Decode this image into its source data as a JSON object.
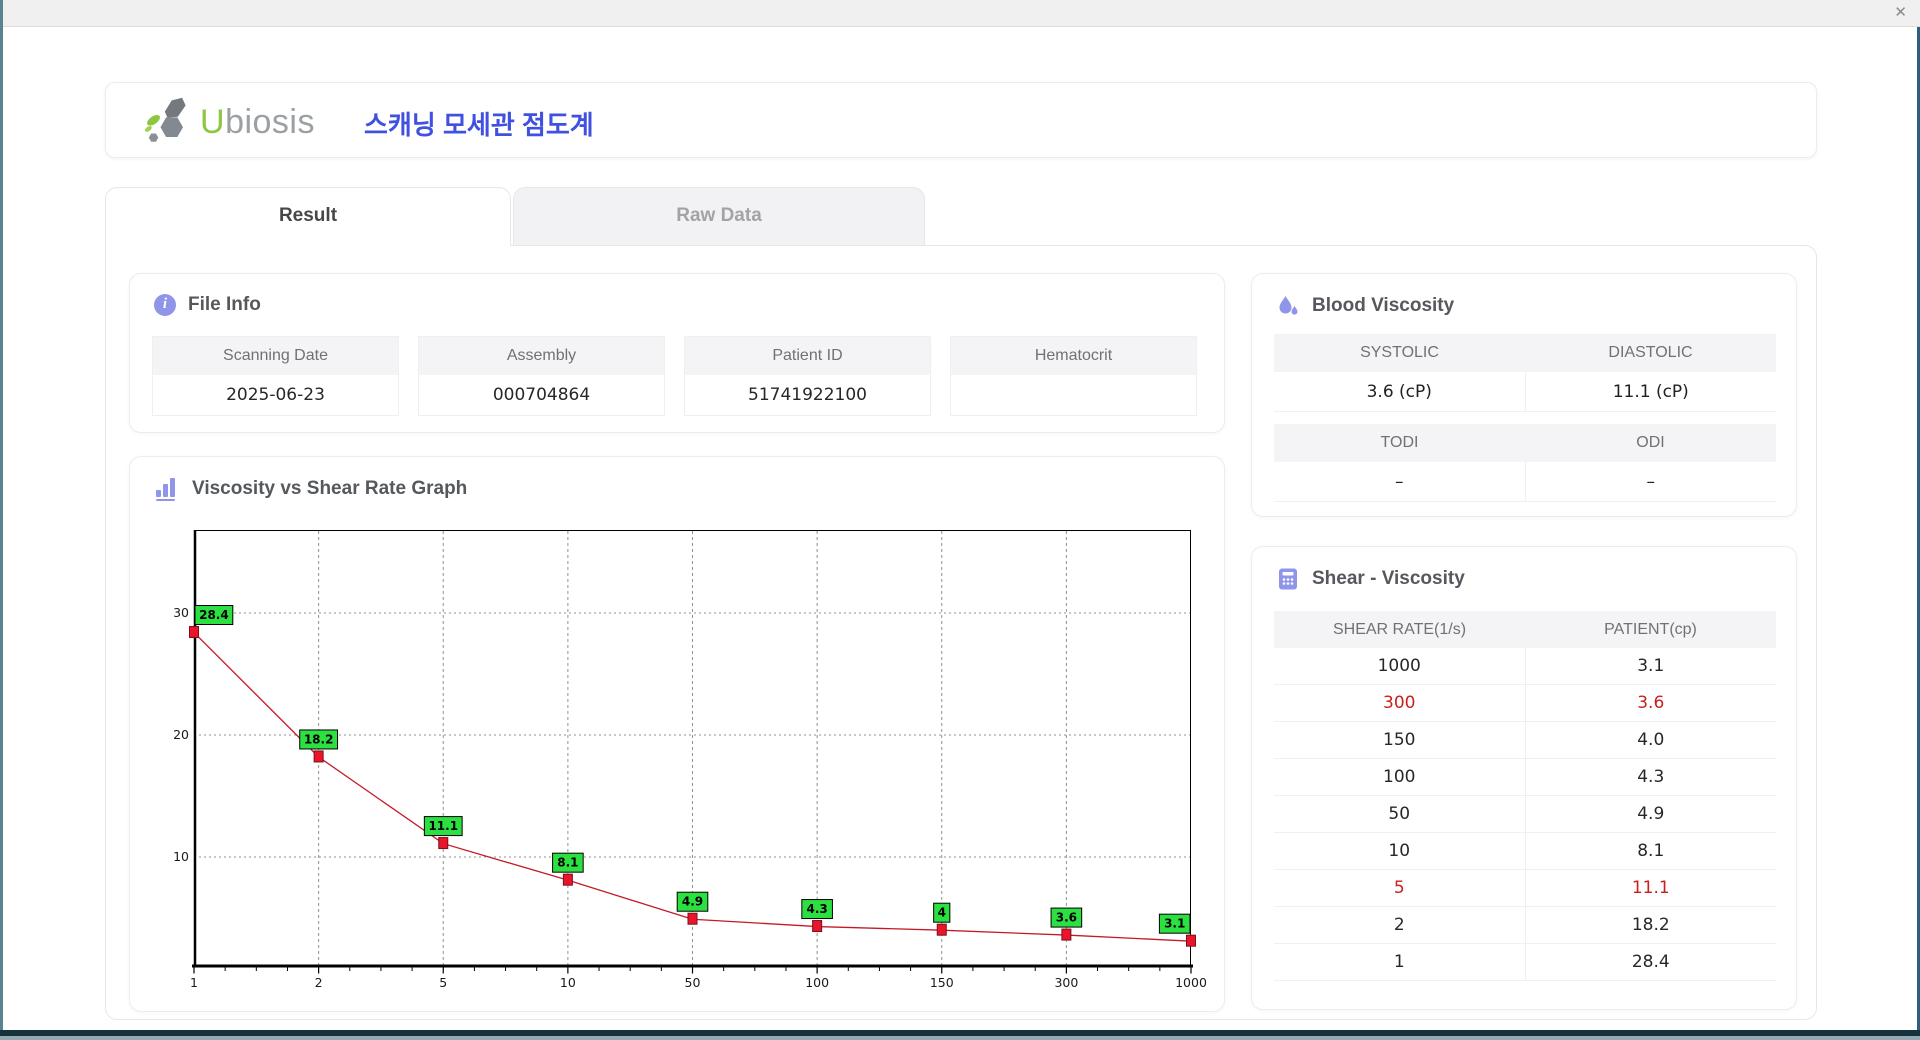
{
  "window": {
    "close_glyph": "✕"
  },
  "header": {
    "logo_u": "U",
    "logo_rest": "biosis",
    "title_ko": "스캐닝 모세관 점도계"
  },
  "tabs": [
    {
      "label": "Result",
      "active": true
    },
    {
      "label": "Raw Data",
      "active": false
    }
  ],
  "file_info": {
    "section_title": "File Info",
    "fields": [
      {
        "label": "Scanning Date",
        "value": "2025-06-23"
      },
      {
        "label": "Assembly",
        "value": "000704864"
      },
      {
        "label": "Patient ID",
        "value": "51741922100"
      },
      {
        "label": "Hematocrit",
        "value": ""
      }
    ]
  },
  "graph": {
    "section_title": "Viscosity vs Shear Rate Graph"
  },
  "blood_viscosity": {
    "section_title": "Blood Viscosity",
    "groups": [
      {
        "headers": [
          "SYSTOLIC",
          "DIASTOLIC"
        ],
        "values": [
          "3.6 (cP)",
          "11.1 (cP)"
        ]
      },
      {
        "headers": [
          "TODI",
          "ODI"
        ],
        "values": [
          "–",
          "–"
        ]
      }
    ]
  },
  "shear_viscosity": {
    "section_title": "Shear - Viscosity",
    "columns": [
      "SHEAR RATE(1/s)",
      "PATIENT(cp)"
    ],
    "rows": [
      {
        "shear_rate": "1000",
        "patient": "3.1",
        "highlight": false
      },
      {
        "shear_rate": "300",
        "patient": "3.6",
        "highlight": true
      },
      {
        "shear_rate": "150",
        "patient": "4.0",
        "highlight": false
      },
      {
        "shear_rate": "100",
        "patient": "4.3",
        "highlight": false
      },
      {
        "shear_rate": "50",
        "patient": "4.9",
        "highlight": false
      },
      {
        "shear_rate": "10",
        "patient": "8.1",
        "highlight": false
      },
      {
        "shear_rate": "5",
        "patient": "11.1",
        "highlight": true
      },
      {
        "shear_rate": "2",
        "patient": "18.2",
        "highlight": false
      },
      {
        "shear_rate": "1",
        "patient": "28.4",
        "highlight": false
      }
    ]
  },
  "chart_data": {
    "type": "line",
    "title": "Viscosity vs Shear Rate Graph",
    "x_categories": [
      "1",
      "2",
      "5",
      "10",
      "50",
      "100",
      "150",
      "300",
      "1000"
    ],
    "series": [
      {
        "name": "PATIENT(cp)",
        "values": [
          28.4,
          18.2,
          11.1,
          8.1,
          4.9,
          4.3,
          4.0,
          3.6,
          3.1
        ]
      }
    ],
    "point_labels": [
      "28.4",
      "18.2",
      "11.1",
      "8.1",
      "4.9",
      "4.3",
      "4",
      "3.6",
      "3.1"
    ],
    "y_ticks": [
      10,
      20,
      30
    ],
    "ylim": [
      1.0,
      36.7
    ],
    "x_scale": "categorical spacing of log-valued shear rates",
    "grid": true,
    "legend": "none",
    "colors": {
      "line": "#c41a28",
      "marker": "#e8152b",
      "marker_border": "#7d0f1a",
      "label_bg": "#2ce042",
      "label_border": "#000000",
      "gridline": "#909090",
      "axis": "#000000"
    }
  },
  "colors": {
    "accent_periwinkle": "#8f96ea",
    "title_blue": "#4050e0",
    "logo_green": "#8dc63f",
    "highlight_red": "#c8201d",
    "table_header_bg": "#f4f4f6",
    "frame_teal": "#2f5f7d"
  }
}
